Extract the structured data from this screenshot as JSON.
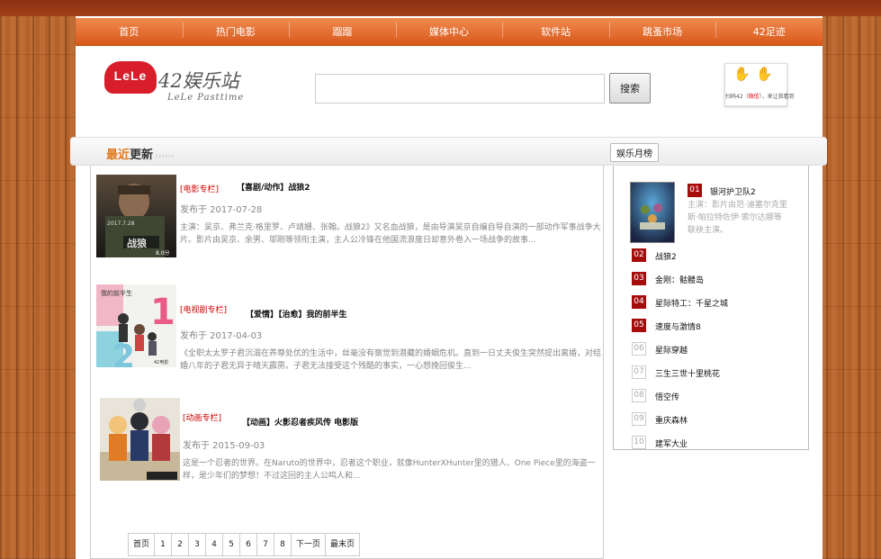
{
  "nav": {
    "items": [
      "首页",
      "热门电影",
      "蹓蹓",
      "媒体中心",
      "软件站",
      "跳蚤市场",
      "42足迹"
    ]
  },
  "logo": {
    "badge": "LeLe",
    "name": "42娱乐站",
    "sub": "LeLe Pasttime"
  },
  "search": {
    "placeholder": "",
    "value": "",
    "button": "搜索"
  },
  "qr": {
    "hands": "✋✋",
    "caption_pre": "扫码42（",
    "caption_hl": "微信",
    "caption_post": "），来让我看到"
  },
  "latest": {
    "title_hl": "最近",
    "title_rest": "更新",
    "arrows": "››››››"
  },
  "rank_tab": "娱乐月榜",
  "items": [
    {
      "category": "[电影专栏]",
      "title": "【喜剧/动作】战狼2",
      "date": "发布于 2017-07-28",
      "desc": "主演：吴京、弗兰克·格里罗、卢靖姗、张翰。战狼2》又名血战狼，是由导演吴京自编自导自演的一部动作军事战争大片。影片由吴京、余男、邬刚等领衔主演，主人公冷锋在他国流浪度日却意外卷入一场战争的故事..."
    },
    {
      "category": "[电视剧专栏]",
      "title": "【爱情】【治愈】我的前半生",
      "date": "发布于 2017-04-03",
      "desc": "《全职太太罗子君沉溺在养尊处优的生活中，丝毫没有察觉到潜藏的婚姻危机。直到一日丈夫俊生突然提出离婚，对结婚八年的子君无异于晴天霹雳。子君无法接受这个残酷的事实，一心想挽回俊生..."
    },
    {
      "category": "[动画专栏]",
      "title": "【动画】火影忍者疾风传 电影版",
      "date": "发布于 2015-09-03",
      "desc": "这是一个忍者的世界。在Naruto的世界中，忍者这个职业，就像HunterXHunter里的猎人、One Piece里的海盗一样，是少年们的梦想！不过这回的主人公鸣人和..."
    }
  ],
  "poster_text": {
    "p1_date": "2017.7.28",
    "p1_rating": "8.0分",
    "p2_title": "我的前半生",
    "p2_rating": "42电影"
  },
  "pager": [
    "首页",
    "1",
    "2",
    "3",
    "4",
    "5",
    "6",
    "7",
    "8",
    "下一页",
    "最末页"
  ],
  "rank": {
    "top_actors": "主演：影片由范·迪塞尔克里斯·帕拉特佐伊·索尔达娜等联袂主演。",
    "entries": [
      {
        "num": "01",
        "name": "银河护卫队2"
      },
      {
        "num": "02",
        "name": "战狼2"
      },
      {
        "num": "03",
        "name": "金刚：骷髅岛"
      },
      {
        "num": "04",
        "name": "星际特工：千星之城"
      },
      {
        "num": "05",
        "name": "速度与激情8"
      },
      {
        "num": "06",
        "name": "星际穿越"
      },
      {
        "num": "07",
        "name": "三生三世十里桃花"
      },
      {
        "num": "08",
        "name": "悟空传"
      },
      {
        "num": "09",
        "name": "重庆森林"
      },
      {
        "num": "10",
        "name": "建军大业"
      }
    ]
  },
  "colors": {
    "nav_top": "#f08a4e",
    "nav_bottom": "#d9581b",
    "rank_hot": "#a50d0d",
    "category_red": "#cc0000",
    "wood": "#b5622a"
  }
}
